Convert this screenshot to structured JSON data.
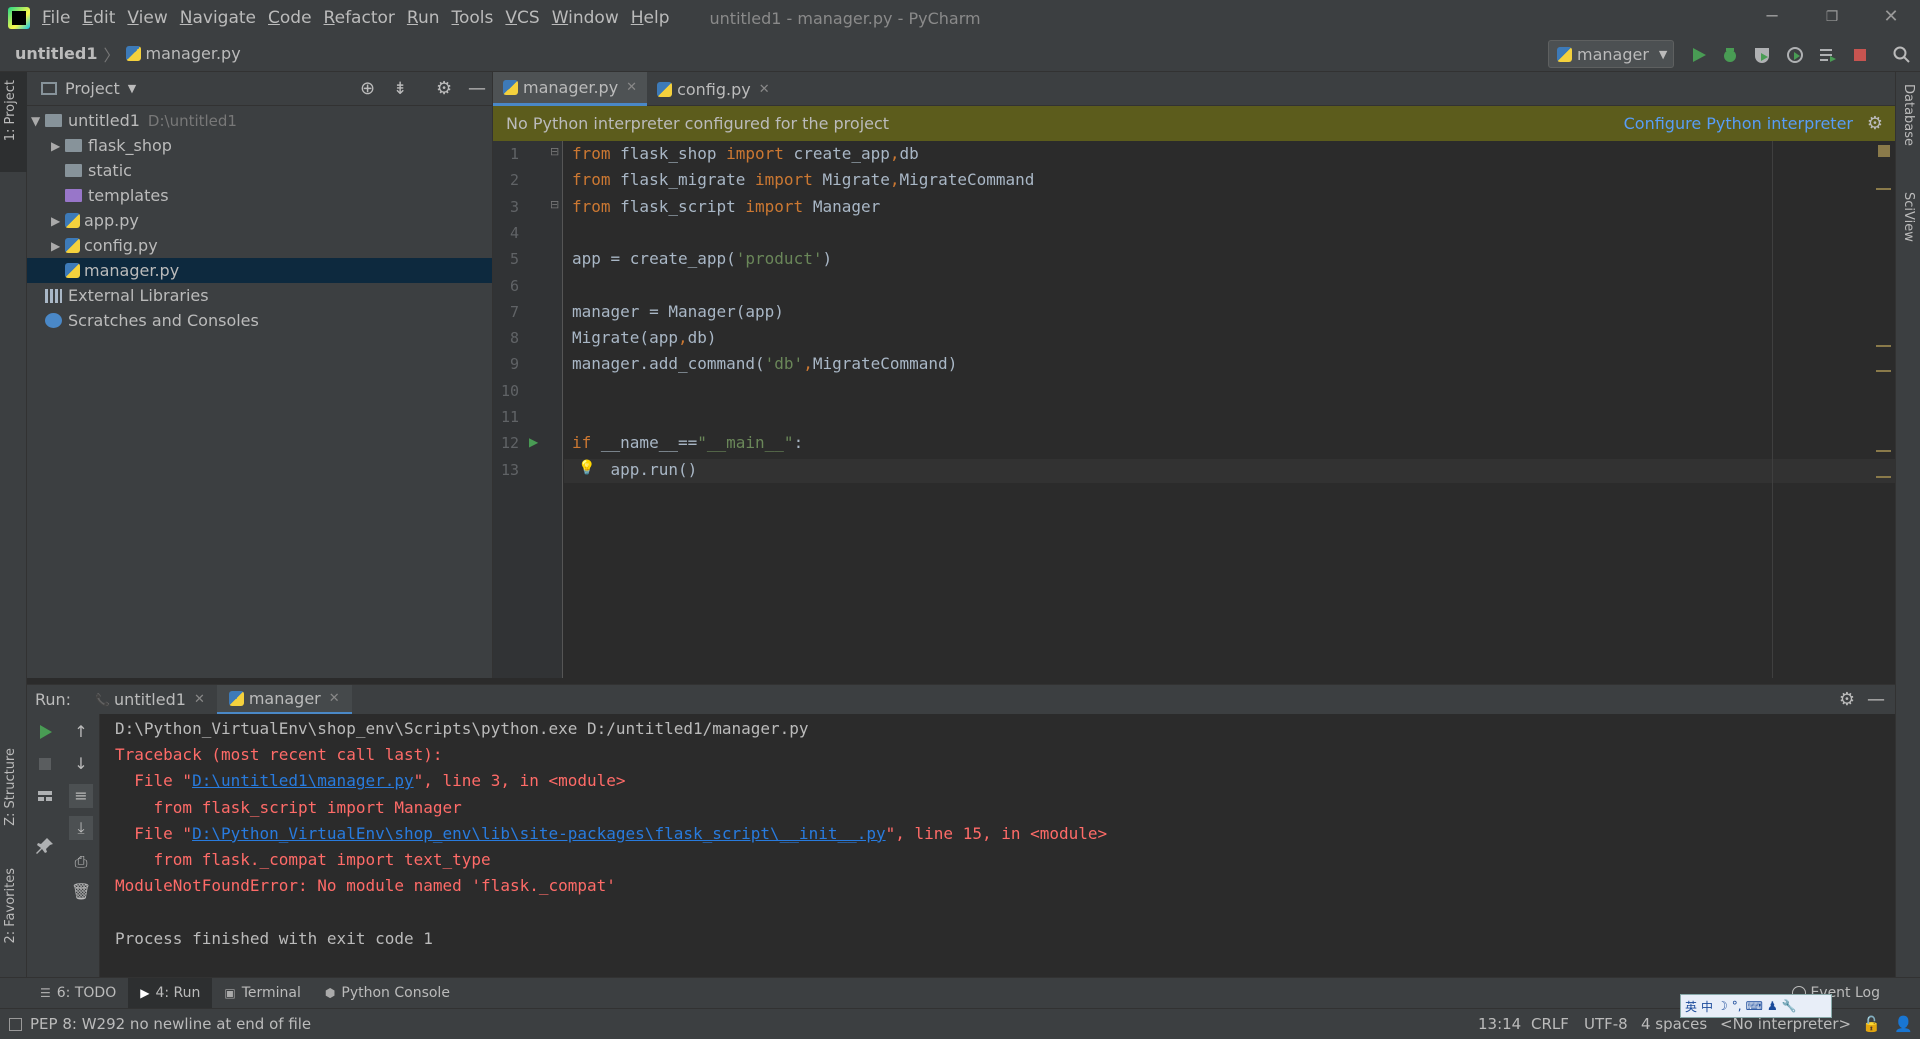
{
  "window": {
    "title": "untitled1 - manager.py - PyCharm",
    "menu": [
      "File",
      "Edit",
      "View",
      "Navigate",
      "Code",
      "Refactor",
      "Run",
      "Tools",
      "VCS",
      "Window",
      "Help"
    ],
    "minimize": "─",
    "restore": "❐",
    "close": "✕"
  },
  "navbar": {
    "project": "untitled1",
    "file": "manager.py",
    "run_config": "manager"
  },
  "stripes": {
    "left_top": "1: Project",
    "left_structure": "Z: Structure",
    "left_favorites": "2: Favorites",
    "right_database": "Database",
    "right_sciview": "SciView"
  },
  "project_panel": {
    "title": "Project",
    "tree": [
      {
        "label": "untitled1",
        "hint": "D:\\untitled1",
        "indent": 0,
        "arrow": "▼",
        "icon": "folder-icon"
      },
      {
        "label": "flask_shop",
        "indent": 1,
        "arrow": "▶",
        "icon": "folder-icon"
      },
      {
        "label": "static",
        "indent": 1,
        "arrow": "",
        "icon": "folder-icon"
      },
      {
        "label": "templates",
        "indent": 1,
        "arrow": "",
        "icon": "folder-purple-icon"
      },
      {
        "label": "app.py",
        "indent": 1,
        "arrow": "▶",
        "icon": "python-file-icon"
      },
      {
        "label": "config.py",
        "indent": 1,
        "arrow": "▶",
        "icon": "python-file-icon"
      },
      {
        "label": "manager.py",
        "indent": 1,
        "arrow": "",
        "icon": "python-file-icon",
        "selected": true
      },
      {
        "label": "External Libraries",
        "indent": 0,
        "arrow": "",
        "icon": "library-icon"
      },
      {
        "label": "Scratches and Consoles",
        "indent": 0,
        "arrow": "",
        "icon": "scratches-icon"
      }
    ]
  },
  "editor": {
    "tabs": [
      {
        "label": "manager.py",
        "active": true
      },
      {
        "label": "config.py",
        "active": false
      }
    ],
    "banner": "No Python interpreter configured for the project",
    "banner_link": "Configure Python interpreter",
    "line_numbers": [
      "1",
      "2",
      "3",
      "4",
      "5",
      "6",
      "7",
      "8",
      "9",
      "10",
      "11",
      "12",
      "13"
    ],
    "lines": [
      [
        {
          "t": "from",
          "c": "kw"
        },
        {
          "t": " flask_shop ",
          "c": ""
        },
        {
          "t": "import",
          "c": "kw"
        },
        {
          "t": " create_app",
          "c": ""
        },
        {
          "t": ",",
          "c": "kw"
        },
        {
          "t": "db",
          "c": ""
        }
      ],
      [
        {
          "t": "from",
          "c": "kw"
        },
        {
          "t": " flask_migrate ",
          "c": ""
        },
        {
          "t": "import",
          "c": "kw"
        },
        {
          "t": " Migrate",
          "c": ""
        },
        {
          "t": ",",
          "c": "kw"
        },
        {
          "t": "MigrateCommand",
          "c": ""
        }
      ],
      [
        {
          "t": "from",
          "c": "kw"
        },
        {
          "t": " flask_script ",
          "c": ""
        },
        {
          "t": "import",
          "c": "kw"
        },
        {
          "t": " Manager",
          "c": ""
        }
      ],
      [],
      [
        {
          "t": "app = create_app(",
          "c": ""
        },
        {
          "t": "'product'",
          "c": "str"
        },
        {
          "t": ")",
          "c": ""
        }
      ],
      [],
      [
        {
          "t": "manager = Manager(app)",
          "c": ""
        }
      ],
      [
        {
          "t": "Migrate(app",
          "c": ""
        },
        {
          "t": ",",
          "c": "kw"
        },
        {
          "t": "db)",
          "c": ""
        }
      ],
      [
        {
          "t": "manager.add_command(",
          "c": ""
        },
        {
          "t": "'db'",
          "c": "str"
        },
        {
          "t": ",",
          "c": "kw"
        },
        {
          "t": "MigrateCommand)",
          "c": ""
        }
      ],
      [],
      [],
      [
        {
          "t": "if",
          "c": "kw"
        },
        {
          "t": " __name__==",
          "c": ""
        },
        {
          "t": "\"__main__\"",
          "c": "str"
        },
        {
          "t": ":",
          "c": ""
        }
      ],
      [
        {
          "t": "    app.run()",
          "c": ""
        }
      ]
    ]
  },
  "run_panel": {
    "label": "Run:",
    "tabs": [
      {
        "label": "untitled1",
        "active": false
      },
      {
        "label": "manager",
        "active": true
      }
    ],
    "console": [
      {
        "parts": [
          {
            "t": "D:\\Python_VirtualEnv\\shop_env\\Scripts\\python.exe D:/untitled1/manager.py",
            "c": "c-plain"
          }
        ]
      },
      {
        "parts": [
          {
            "t": "Traceback (most recent call last):",
            "c": "c-err"
          }
        ]
      },
      {
        "parts": [
          {
            "t": "  File \"",
            "c": "c-err"
          },
          {
            "t": "D:\\untitled1\\manager.py",
            "c": "c-link"
          },
          {
            "t": "\", line 3, in <module>",
            "c": "c-err"
          }
        ]
      },
      {
        "parts": [
          {
            "t": "    from flask_script import Manager",
            "c": "c-err"
          }
        ]
      },
      {
        "parts": [
          {
            "t": "  File \"",
            "c": "c-err"
          },
          {
            "t": "D:\\Python_VirtualEnv\\shop_env\\lib\\site-packages\\flask_script\\__init__.py",
            "c": "c-link"
          },
          {
            "t": "\", line 15, in <module>",
            "c": "c-err"
          }
        ]
      },
      {
        "parts": [
          {
            "t": "    from flask._compat import text_type",
            "c": "c-err"
          }
        ]
      },
      {
        "parts": [
          {
            "t": "ModuleNotFoundError: No module named 'flask._compat'",
            "c": "c-err"
          }
        ]
      },
      {
        "parts": []
      },
      {
        "parts": [
          {
            "t": "Process finished with exit code 1",
            "c": "c-plain"
          }
        ]
      }
    ]
  },
  "bottom_tabs": [
    {
      "label": "6: TODO",
      "active": false
    },
    {
      "label": "4: Run",
      "active": true
    },
    {
      "label": "Terminal",
      "active": false
    },
    {
      "label": "Python Console",
      "active": false
    }
  ],
  "event_log": "Event Log",
  "statusbar": {
    "message": "PEP 8: W292 no newline at end of file",
    "position": "13:14",
    "line_sep": "CRLF",
    "encoding": "UTF-8",
    "indent": "4 spaces",
    "interpreter": "<No interpreter>"
  },
  "ime": [
    "英",
    "中",
    "☽",
    "°,",
    "⌨",
    "♟",
    "🔧"
  ]
}
